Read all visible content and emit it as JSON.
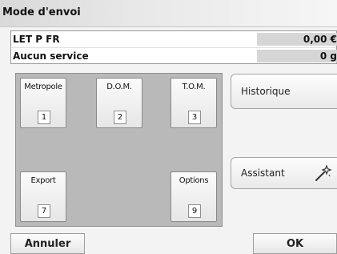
{
  "window": {
    "title": "Mode d'envoi"
  },
  "info": {
    "product": {
      "label": "LET P FR",
      "value": "0,00 €"
    },
    "service": {
      "label": "Aucun service",
      "value": "0 g"
    }
  },
  "regions": [
    {
      "label": "Metropole",
      "number": "1"
    },
    {
      "label": "D.O.M.",
      "number": "2"
    },
    {
      "label": "T.O.M.",
      "number": "3"
    },
    {
      "label": "Export",
      "number": "7"
    },
    {
      "label": "Options",
      "number": "9"
    }
  ],
  "side_buttons": {
    "history_label": "Historique",
    "assistant_label": "Assistant",
    "assistant_icon": "magic-wand-icon"
  },
  "footer": {
    "cancel_label": "Annuler",
    "ok_label": "OK"
  }
}
